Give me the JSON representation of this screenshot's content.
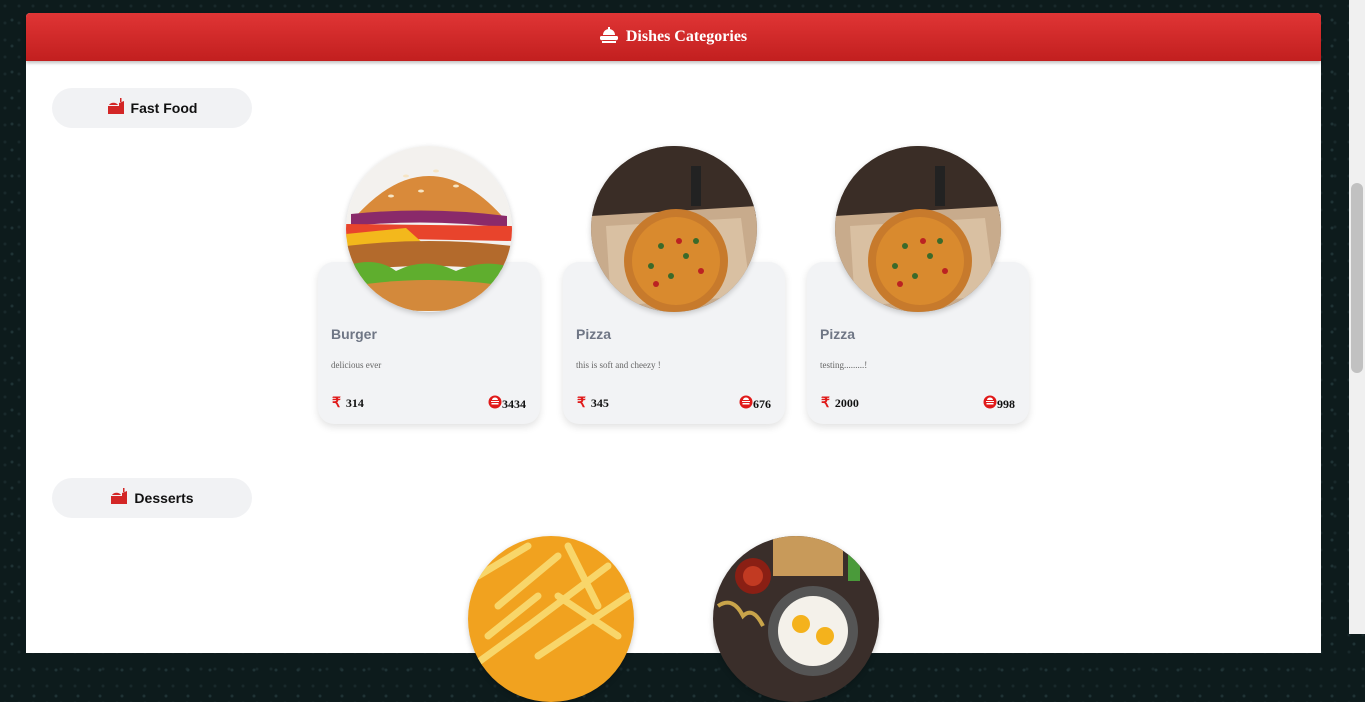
{
  "header": {
    "title": "Dishes Categories",
    "icon": "dish-icon"
  },
  "colors": {
    "accent": "#d32626",
    "card_bg": "#f2f3f5",
    "pill_bg": "#f1f2f4"
  },
  "categories": [
    {
      "name": "Fast Food",
      "dishes": [
        {
          "name": "Burger",
          "description": "delicious ever",
          "price": "314",
          "count": "3434",
          "image": "burger"
        },
        {
          "name": "Pizza",
          "description": "this is soft and cheezy !",
          "price": "345",
          "count": "676",
          "image": "pizza"
        },
        {
          "name": "Pizza",
          "description": "testing.........!",
          "price": "2000",
          "count": "998",
          "image": "pizza"
        }
      ]
    },
    {
      "name": "Desserts",
      "dishes": [
        {
          "image": "fries"
        },
        {
          "image": "breakfast"
        }
      ]
    }
  ],
  "currency_symbol": "₹"
}
